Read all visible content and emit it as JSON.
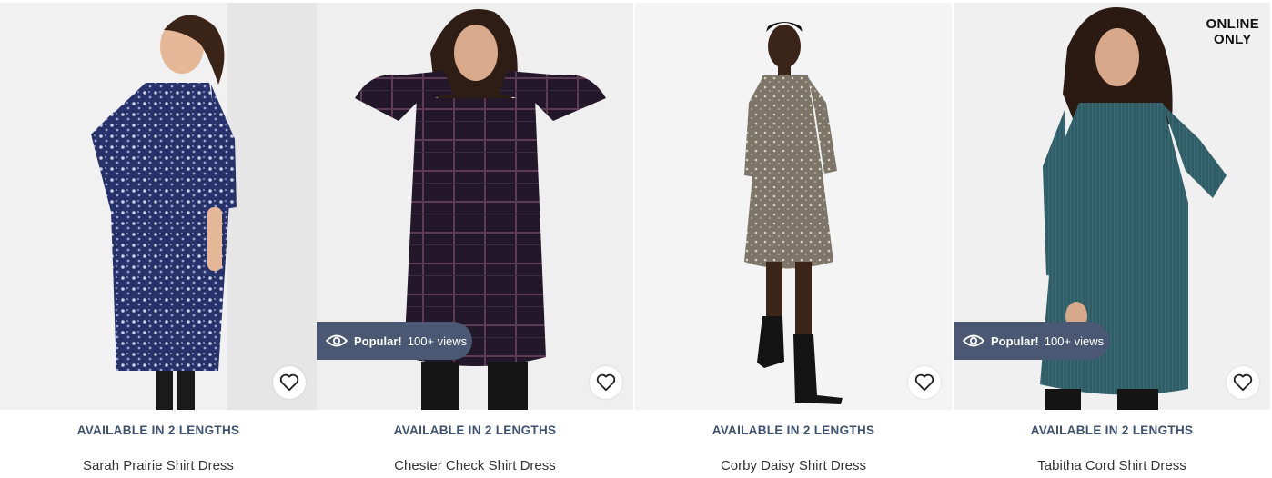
{
  "products": [
    {
      "name": "Sarah Prairie Shirt Dress",
      "availability": "AVAILABLE IN 2 LENGTHS",
      "badge": null,
      "tag": null,
      "dress_color": "#2a3566",
      "dress_pattern": "floral-navy"
    },
    {
      "name": "Chester Check Shirt Dress",
      "availability": "AVAILABLE IN 2 LENGTHS",
      "badge": {
        "popular": "Popular!",
        "views": "100+ views"
      },
      "tag": null,
      "dress_color": "#251a2c",
      "dress_pattern": "check"
    },
    {
      "name": "Corby Daisy Shirt Dress",
      "availability": "AVAILABLE IN 2 LENGTHS",
      "badge": null,
      "tag": null,
      "dress_color": "#7b7466",
      "dress_pattern": "daisy"
    },
    {
      "name": "Tabitha Cord Shirt Dress",
      "availability": "AVAILABLE IN 2 LENGTHS",
      "badge": {
        "popular": "Popular!",
        "views": "100+ views"
      },
      "tag": {
        "line1": "ONLINE",
        "line2": "ONLY"
      },
      "dress_color": "#2f5a63",
      "dress_pattern": "cord"
    }
  ],
  "icons": {
    "favourite": "heart-outline-icon",
    "views": "eye-icon"
  },
  "colors": {
    "badge_bg": "#4a5874",
    "availability_text": "#3d5170",
    "image_bg": "#eeeeee"
  }
}
